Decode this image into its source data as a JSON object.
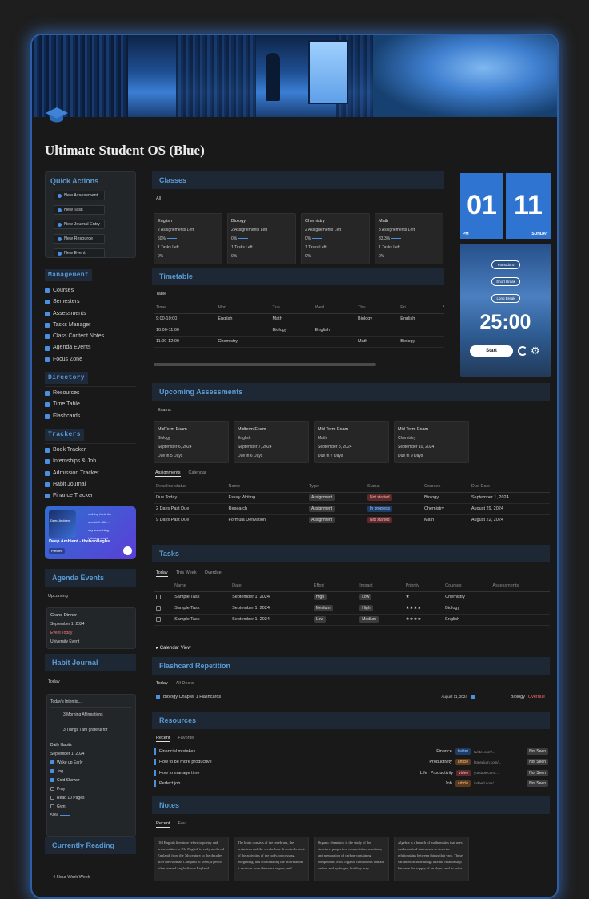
{
  "page": {
    "title": "Ultimate Student OS (Blue)"
  },
  "quick_actions": {
    "title": "Quick Actions",
    "items": [
      "New Assessment",
      "New Task",
      "New Journal Entry",
      "New Resource",
      "New Event"
    ]
  },
  "management": {
    "title": "Management",
    "items": [
      "Courses",
      "Semesters",
      "Assessments",
      "Tasks Manager",
      "Class Content Notes",
      "Agenda Events",
      "Focus Zone"
    ]
  },
  "directory": {
    "title": "Directory",
    "items": [
      "Resources",
      "Time Table",
      "Flashcards"
    ]
  },
  "trackers": {
    "title": "Trackers",
    "items": [
      "Book Tracker",
      "Internships & Job",
      "Admission Tracker",
      "Habit Journal",
      "Finance Tracker"
    ]
  },
  "music": {
    "title": "Deep Ambient - thebootleghs",
    "badge": "Preview",
    "cover": "Deep Ambient",
    "tracks": [
      "nothing feels the",
      "snowfall - Øn...",
      "say something -",
      "i always could"
    ]
  },
  "agenda": {
    "title": "Agenda Events",
    "view": "Upcoming",
    "event": {
      "name": "Grand Dinner",
      "date": "September 1, 2024",
      "status": "Event Today",
      "place": "University Event"
    }
  },
  "habit": {
    "title": "Habit Journal",
    "view": "Today",
    "entry": "Today's Intentio...",
    "items": [
      "3 Morning Affirmations",
      "3 Things I am grateful for"
    ],
    "daily": {
      "title": "Daily Habits",
      "date": "September 1, 2024",
      "habits": [
        {
          "label": "Wake up Early",
          "done": true
        },
        {
          "label": "Jog",
          "done": true
        },
        {
          "label": "Cold Shower",
          "done": true
        },
        {
          "label": "Pray",
          "done": false
        },
        {
          "label": "Read 10 Pages",
          "done": false
        },
        {
          "label": "Gym",
          "done": false
        }
      ],
      "progress": "50%"
    }
  },
  "reading": {
    "title": "Currently Reading",
    "book": "4-Hour Work Week"
  },
  "classes": {
    "title": "Classes",
    "view": "All",
    "items": [
      {
        "name": "English",
        "assign": "2 Assignements Left",
        "pct": "50%",
        "tasks": "1 Tasks Left",
        "tpct": "0%"
      },
      {
        "name": "Biology",
        "assign": "2 Assignements Left",
        "pct": "0%",
        "tasks": "1 Tasks Left",
        "tpct": "0%"
      },
      {
        "name": "Chemistry",
        "assign": "2 Assignements Left",
        "pct": "0%",
        "tasks": "1 Tasks Left",
        "tpct": "0%"
      },
      {
        "name": "Math",
        "assign": "3 Assignements Left",
        "pct": "33.3%",
        "tasks": "1 Tasks Left",
        "tpct": "0%"
      }
    ]
  },
  "timetable": {
    "title": "Timetable",
    "view": "Table",
    "cols": [
      "Time",
      "Mon",
      "Tue",
      "Wed",
      "Thu",
      "Fri",
      "S"
    ],
    "rows": [
      [
        "9:00-10:00",
        "English",
        "Math",
        "",
        "Biology",
        "English"
      ],
      [
        "10:00-11:00",
        "",
        "Biology",
        "English",
        "",
        ""
      ],
      [
        "11:00-12:00",
        "Chemistry",
        "",
        "",
        "Math",
        "Biology"
      ]
    ]
  },
  "clock": {
    "hour": "01",
    "minute": "11",
    "ampm": "PM",
    "day": "SUNDAY"
  },
  "pomodoro": {
    "buttons": [
      "Pomodoro",
      "Short Break",
      "Long Break"
    ],
    "time": "25:00",
    "start": "Start"
  },
  "assessments": {
    "title": "Upcoming Assessments",
    "view": "Exams",
    "exams": [
      {
        "name": "MidTerm Exam",
        "course": "Biology",
        "date": "September 6, 2024",
        "due": "Due in 5 Days"
      },
      {
        "name": "Midterm Exam",
        "course": "English",
        "date": "September 7, 2024",
        "due": "Due in 6 Days"
      },
      {
        "name": "Mid Term Exam",
        "course": "Math",
        "date": "September 8, 2024",
        "due": "Due in 7 Days"
      },
      {
        "name": "Mid Term Exam",
        "course": "Chemistry",
        "date": "September 10, 2024",
        "due": "Due in 9 Days"
      }
    ],
    "tabs": [
      "Assignments",
      "Calendar"
    ],
    "cols": [
      "Deadline status",
      "Name",
      "Type",
      "Status",
      "Courses",
      "Due Date"
    ],
    "rows": [
      [
        "Due Today",
        "Essay Writing",
        "Assignment",
        "Not started",
        "Biology",
        "September 1, 2024"
      ],
      [
        "2 Days Past Due",
        "Research",
        "Assignment",
        "In progress",
        "Chemistry",
        "August 29, 2024"
      ],
      [
        "9 Days Past Due",
        "Formula Derivation",
        "Assignment",
        "Not started",
        "Math",
        "August 22, 2024"
      ]
    ]
  },
  "tasks": {
    "title": "Tasks",
    "tabs": [
      "Today",
      "This Week",
      "Overdue"
    ],
    "cols": [
      "Name",
      "Date",
      "Effort",
      "Impact",
      "Priority",
      "Courses",
      "Assessments"
    ],
    "rows": [
      [
        "Sample Task",
        "September 1, 2024",
        "High",
        "Low",
        "★",
        "Chemistry"
      ],
      [
        "Sample Task",
        "September 1, 2024",
        "Medium",
        "High",
        "★★★★",
        "Biology"
      ],
      [
        "Sample Task",
        "September 1, 2024",
        "Low",
        "Medium",
        "★★★★",
        "English"
      ]
    ],
    "calendar": "Calendar View"
  },
  "flashcards": {
    "title": "Flashcard Repetition",
    "tabs": [
      "Today",
      "All Decks"
    ],
    "row": {
      "name": "Biology Chapter 1 Flashcards",
      "date": "August 11, 2024",
      "course": "Biology",
      "status": "Overdue"
    }
  },
  "resources": {
    "title": "Resources",
    "tabs": [
      "Recent",
      "Favorite"
    ],
    "rows": [
      {
        "name": "Financial mistakes",
        "cat": "Finance",
        "type": "twitter",
        "url": "twitter.com/...",
        "status": "Not Seen"
      },
      {
        "name": "How to be more productive",
        "cat": "Productivity",
        "type": "article",
        "url": "fsmedium.com/...",
        "status": "Not Seen"
      },
      {
        "name": "How to manage time",
        "cat": "Productivity",
        "cat2": "Life",
        "type": "video",
        "url": "youtube.com/...",
        "status": "Not Seen"
      },
      {
        "name": "Perfect job",
        "cat": "Job",
        "type": "article",
        "url": "indeed.com/...",
        "status": "Not Seen"
      }
    ]
  },
  "notes": {
    "title": "Notes",
    "tabs": [
      "Recent",
      "Fav"
    ],
    "items": [
      "Old English literature refers to poetry and prose written in Old English in early medieval England, from the 7th century to the decades after the Norman Conquest of 1066, a period often termed Anglo-Saxon England.",
      "The brain consists of the cerebrum, the brainstem and the cerebellum. It controls most of the activities of the body, processing, integrating, and coordinating the information it receives from the sense organs, and",
      "Organic chemistry is the study of the structure, properties, composition, reactions, and preparation of carbon-containing compounds. Most organic compounds contain carbon and hydrogen, but they may",
      "Algebra is a branch of mathematics that uses mathematical statements to describe relationships between things that vary. These variables include things like the relationship between the supply of an object and its price."
    ]
  }
}
